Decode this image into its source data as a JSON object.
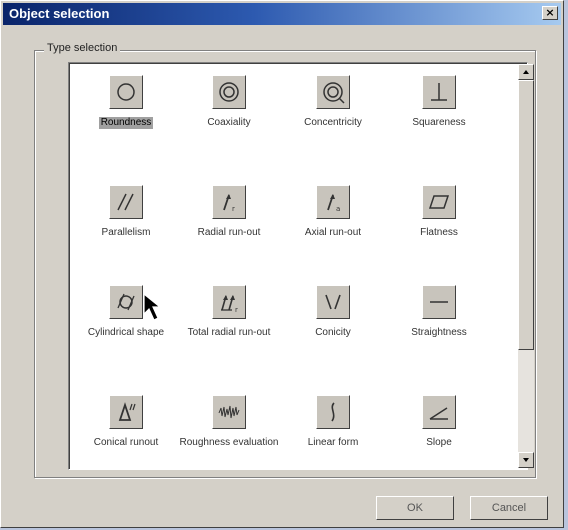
{
  "window": {
    "title": "Object selection",
    "close_label": "×"
  },
  "group": {
    "label": "Type selection"
  },
  "items": [
    {
      "label": "Roundness",
      "icon": "roundness-icon",
      "selected": true
    },
    {
      "label": "Coaxiality",
      "icon": "coaxiality-icon"
    },
    {
      "label": "Concentricity",
      "icon": "concentricity-icon"
    },
    {
      "label": "Squareness",
      "icon": "squareness-icon"
    },
    {
      "label": "Parallelism",
      "icon": "parallelism-icon"
    },
    {
      "label": "Radial run-out",
      "icon": "radial-runout-icon"
    },
    {
      "label": "Axial run-out",
      "icon": "axial-runout-icon"
    },
    {
      "label": "Flatness",
      "icon": "flatness-icon"
    },
    {
      "label": "Cylindrical shape",
      "icon": "cylindricity-icon"
    },
    {
      "label": "Total radial run-out",
      "icon": "total-radial-runout-icon"
    },
    {
      "label": "Conicity",
      "icon": "conicity-icon"
    },
    {
      "label": "Straightness",
      "icon": "straightness-icon"
    },
    {
      "label": "Conical runout",
      "icon": "conical-runout-icon"
    },
    {
      "label": "Roughness evaluation",
      "icon": "roughness-icon"
    },
    {
      "label": "Linear form",
      "icon": "linear-form-icon"
    },
    {
      "label": "Slope",
      "icon": "slope-icon"
    }
  ],
  "buttons": {
    "ok": "OK",
    "cancel": "Cancel"
  }
}
